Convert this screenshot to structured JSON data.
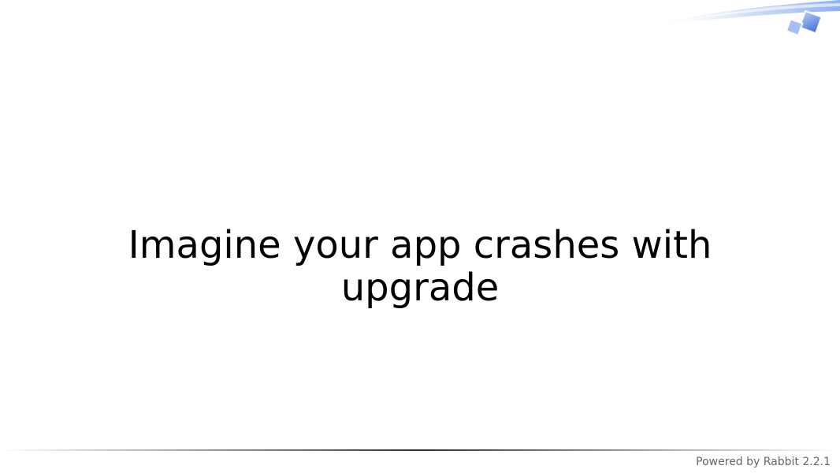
{
  "slide": {
    "title": "Imagine your app crashes with upgrade"
  },
  "footer": {
    "credit": "Powered by Rabbit 2.2.1"
  },
  "decoration": {
    "corner_icon": "rabbit-slide-corner-swoosh",
    "accent_color": "#4a7fe0",
    "rule_color": "#333333"
  }
}
